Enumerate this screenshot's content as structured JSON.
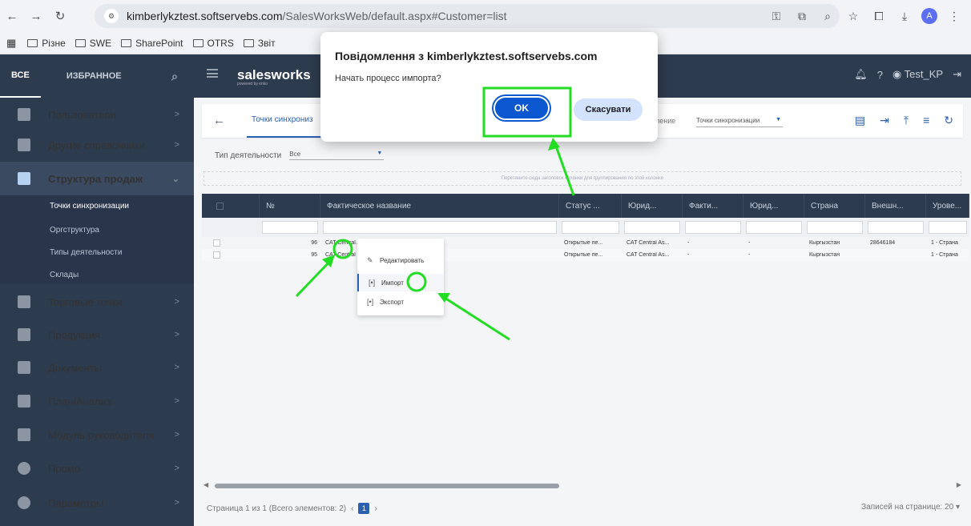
{
  "browser": {
    "url_host": "kimberlykztest.softservebs.com",
    "url_path": "/SalesWorksWeb/default.aspx#Customer=list",
    "profile_initial": "A"
  },
  "bookmarks": [
    "Різне",
    "SWE",
    "SharePoint",
    "OTRS",
    "Звіт"
  ],
  "app": {
    "tab_all": "ВСЕ",
    "tab_favorites": "ИЗБРАННОЕ",
    "logo": "salesworks",
    "logo_sub": "powered by enko",
    "user": "Test_KP"
  },
  "sidebar": {
    "items": [
      {
        "label": "Пользователи",
        "icon": "users-icon"
      },
      {
        "label": "Другие справочники",
        "icon": "book-icon"
      },
      {
        "label": "Структура продаж",
        "icon": "hierarchy-icon"
      },
      {
        "label": "Торговые точки",
        "icon": "store-icon"
      },
      {
        "label": "Продукция",
        "icon": "products-icon"
      },
      {
        "label": "Документы",
        "icon": "document-icon"
      },
      {
        "label": "План/Анализ",
        "icon": "chart-icon"
      },
      {
        "label": "Модуль руководителя",
        "icon": "manager-icon"
      },
      {
        "label": "Промо",
        "icon": "promo-icon"
      },
      {
        "label": "Параметры",
        "icon": "gear-icon"
      }
    ],
    "subitems": [
      "Точки синхронизации",
      "Оргструктура",
      "Типы деятельности",
      "Склады"
    ]
  },
  "content": {
    "tab_title": "Точки синхрониз",
    "view_label": "ление",
    "view_value": "Точки синхронизации",
    "filter_label": "Тип деятельности",
    "filter_value": "Все",
    "group_hint": "Перетяните сюда заголовок колонки для группирования по этой колонке",
    "columns": [
      "№",
      "Фактическое название",
      "Статус ...",
      "Юрид...",
      "Факти...",
      "Юрид...",
      "Страна",
      "Внешн...",
      "Урове..."
    ],
    "rows": [
      {
        "num": "96",
        "name": "CAT Central Asia",
        "status": "Открытые пе...",
        "legal": "CAT Central As...",
        "fact": "-",
        "legal2": "-",
        "country": "Кыргызстан",
        "ext": "28646184",
        "level": "1 - Страна"
      },
      {
        "num": "95",
        "name": "CAT Central",
        "status": "Открытые пе...",
        "legal": "CAT Central As...",
        "fact": "-",
        "legal2": "-",
        "country": "Кыргызстан",
        "ext": "",
        "level": "1 - Страна"
      }
    ],
    "context_menu": [
      "Редактировать",
      "Импорт",
      "Экспорт"
    ],
    "pager_text": "Страница 1 из 1 (Всего элементов: 2)",
    "page_num": "1",
    "page_size": "Записей на странице: 20 ▾"
  },
  "dialog": {
    "title": "Повідомлення з kimberlykztest.softservebs.com",
    "message": "Начать процесс импорта?",
    "ok_label": "OK",
    "cancel_label": "Скасувати"
  },
  "annotation_color": "#22dd22"
}
